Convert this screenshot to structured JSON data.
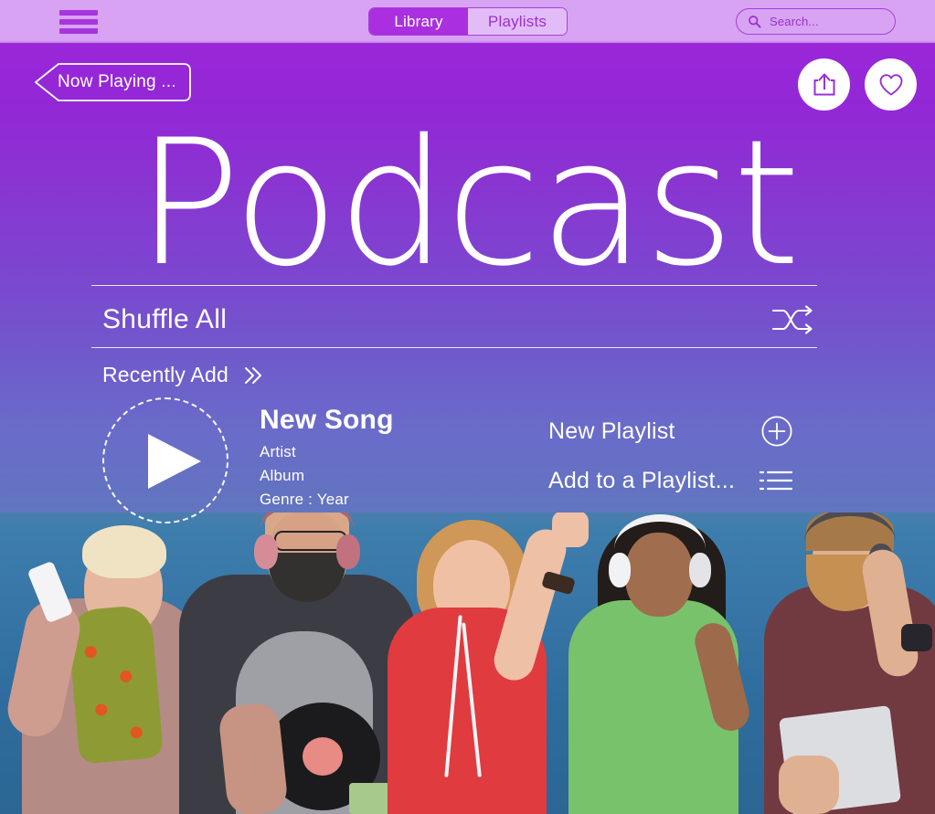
{
  "topbar": {
    "menu_icon": "hamburger-menu-icon",
    "tabs": [
      {
        "label": "Library",
        "active": true
      },
      {
        "label": "Playlists",
        "active": false
      }
    ],
    "search": {
      "icon": "search-icon",
      "placeholder": "Search...",
      "value": ""
    }
  },
  "hero": {
    "back_label": "Now Playing ...",
    "share_icon": "share-icon",
    "favorite_icon": "heart-icon",
    "title": "Podcast",
    "shuffle_label": "Shuffle All",
    "shuffle_icon": "shuffle-icon",
    "recently_label": "Recently Add",
    "recently_icon": "double-chevron-right-icon",
    "play_icon": "play-icon",
    "song": {
      "title": "New Song",
      "artist": "Artist",
      "album": "Album",
      "genre_year": "Genre : Year"
    },
    "playlist_actions": [
      {
        "label": "New Playlist",
        "icon": "plus-circle-icon"
      },
      {
        "label": "Add to a Playlist...",
        "icon": "list-icon"
      }
    ]
  },
  "colors": {
    "topbar_bg": "#d7a3f2",
    "accent_purple": "#a92fdf",
    "gradient_top": "#9a27d9",
    "gradient_mid": "#6a6bc9",
    "gradient_bottom": "#4486a4",
    "text_on_dark": "#ffffff"
  }
}
